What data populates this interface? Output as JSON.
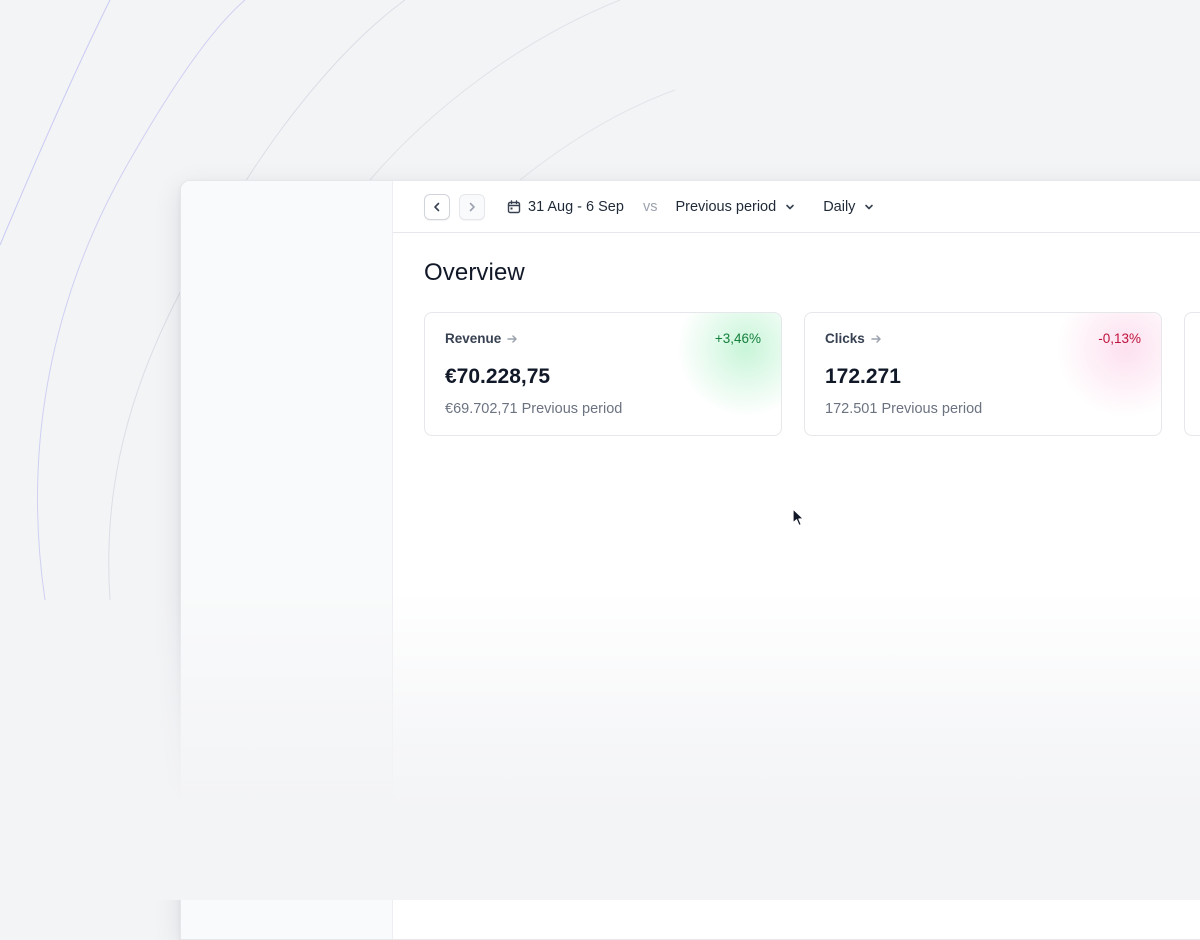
{
  "toolbar": {
    "prev_icon": "chevron-left-icon",
    "next_icon": "chevron-right-icon",
    "date_range_icon": "calendar-icon",
    "date_range": "31 Aug - 6 Sep",
    "vs_label": "vs",
    "comparison": "Previous period",
    "interval": "Daily"
  },
  "main": {
    "title": "Overview",
    "cards": [
      {
        "label": "Revenue",
        "delta": "+3,46%",
        "value": "€70.228,75",
        "previous": "€69.702,71 Previous period",
        "trend": "up"
      },
      {
        "label": "Clicks",
        "delta": "-0,13%",
        "value": "172.271",
        "previous": "172.501 Previous period",
        "trend": "down"
      }
    ]
  },
  "colors": {
    "positive": "#15803d",
    "negative": "#be123c",
    "accent_lines": "#c7c8f5"
  }
}
